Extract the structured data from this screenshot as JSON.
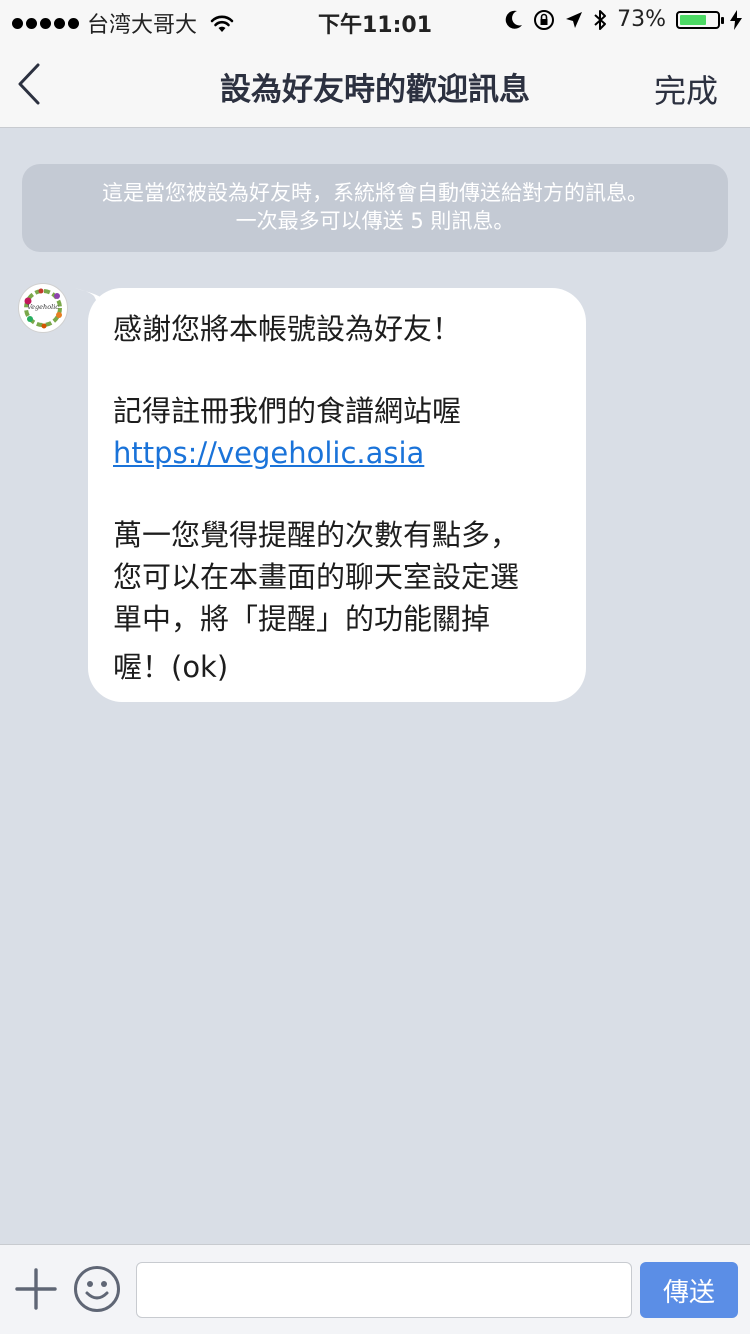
{
  "status_bar": {
    "carrier": "台湾大哥大",
    "time": "下午11:01",
    "battery_percent_label": "73%",
    "battery_level": 0.73,
    "colors": {
      "battery_fill": "#4cd964"
    }
  },
  "nav": {
    "back_icon": "chevron-left-icon",
    "title": "設為好友時的歡迎訊息",
    "done_label": "完成"
  },
  "info_banner": {
    "line1": "這是當您被設為好友時，系統將會自動傳送給對方的訊息。",
    "line2": "一次最多可以傳送 5 則訊息。"
  },
  "message": {
    "avatar_icon": "vegeholic-logo-icon",
    "avatar_text": "Vegeholic",
    "line1": "感謝您將本帳號設為好友！",
    "line2": "記得註冊我們的食譜網站喔",
    "link": "https://vegeholic.asia",
    "line3": "萬一您覺得提醒的次數有點多，",
    "line4": "您可以在本畫面的聊天室設定選",
    "line5": "單中，將「提醒」的功能關掉",
    "line6": "喔！(ok)"
  },
  "input_bar": {
    "plus_icon": "plus-icon",
    "emoji_icon": "smiley-icon",
    "input_value": "",
    "send_label": "傳送",
    "colors": {
      "send_button": "#5b8ee6"
    }
  }
}
